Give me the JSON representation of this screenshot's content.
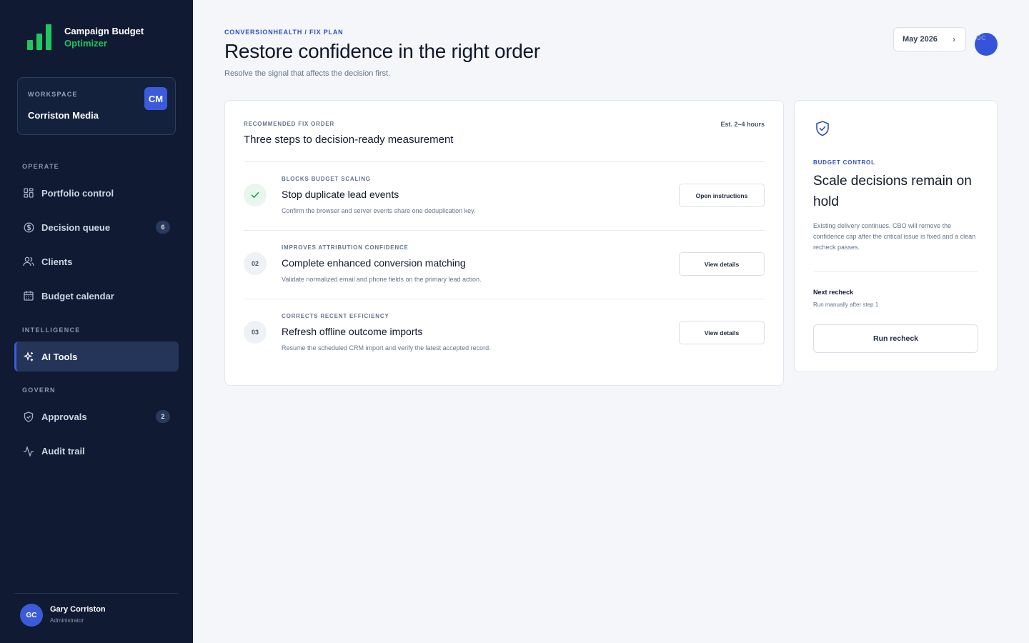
{
  "app": {
    "title_line1": "Campaign Budget",
    "title_line2": "Optimizer",
    "brand_color": "#22c55e",
    "accent_color": "#3b5bdb"
  },
  "workspace": {
    "label": "WORKSPACE",
    "name": "Corriston Media",
    "badge": "CM"
  },
  "sidebar": {
    "sections": [
      {
        "label": "OPERATE"
      },
      {
        "label": "INTELLIGENCE"
      },
      {
        "label": "GOVERN"
      }
    ],
    "items": [
      {
        "label": "Portfolio control",
        "icon": "grid-icon"
      },
      {
        "label": "Decision queue",
        "icon": "dollar-circle-icon",
        "badge": "6"
      },
      {
        "label": "Clients",
        "icon": "users-icon"
      },
      {
        "label": "Budget calendar",
        "icon": "calendar-icon"
      },
      {
        "label": "AI Tools",
        "icon": "sparkle-icon",
        "active": true
      },
      {
        "label": "Approvals",
        "icon": "shield-check-icon",
        "badge": "2"
      },
      {
        "label": "Audit trail",
        "icon": "activity-icon"
      }
    ]
  },
  "user": {
    "initials": "GC",
    "name": "Gary Corriston",
    "role": "Administrator"
  },
  "header": {
    "breadcrumb": "CONVERSIONHEALTH / FIX PLAN",
    "title": "Restore confidence in the right order",
    "subtitle": "Resolve the signal that affects the decision first.",
    "month": "May 2026",
    "avatar_initials": "GC"
  },
  "plan": {
    "kicker": "RECOMMENDED FIX ORDER",
    "title": "Three steps to decision-ready measurement",
    "estimate": "Est. 2–4 hours",
    "steps": [
      {
        "marker": "",
        "status": "done",
        "kicker": "BLOCKS BUDGET SCALING",
        "title": "Stop duplicate lead events",
        "description": "Confirm the browser and server events share one deduplication key.",
        "button": "Open instructions"
      },
      {
        "marker": "02",
        "status": "pending",
        "kicker": "IMPROVES ATTRIBUTION CONFIDENCE",
        "title": "Complete enhanced conversion matching",
        "description": "Validate normalized email and phone fields on the primary lead action.",
        "button": "View details"
      },
      {
        "marker": "03",
        "status": "pending",
        "kicker": "CORRECTS RECENT EFFICIENCY",
        "title": "Refresh offline outcome imports",
        "description": "Resume the scheduled CRM import and verify the latest accepted record.",
        "button": "View details"
      }
    ]
  },
  "control": {
    "kicker": "BUDGET CONTROL",
    "title": "Scale decisions remain on hold",
    "description": "Existing delivery continues. CBO will remove the confidence cap after the critical issue is fixed and a clean recheck passes.",
    "next_label": "Next recheck",
    "next_sub": "Run manually after step 1",
    "button": "Run recheck"
  }
}
